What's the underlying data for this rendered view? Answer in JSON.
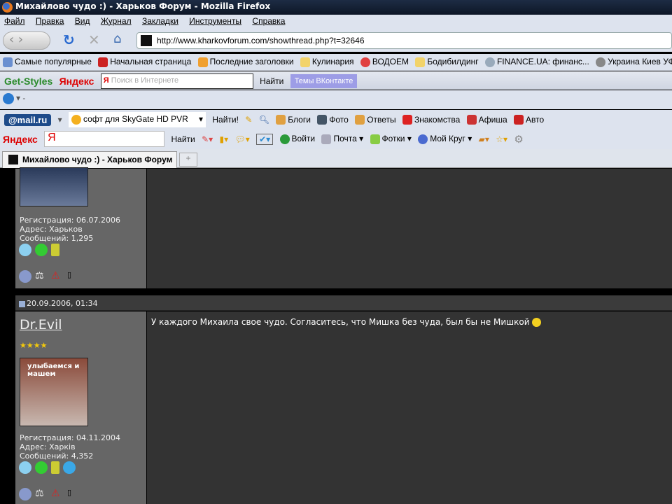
{
  "window": {
    "title": "Михайлово чудо :) - Харьков Форум - Mozilla Firefox"
  },
  "menu": [
    "Файл",
    "Правка",
    "Вид",
    "Журнал",
    "Закладки",
    "Инструменты",
    "Справка"
  ],
  "nav": {
    "url": "http://www.kharkovforum.com/showthread.php?t=32646"
  },
  "bookmarks": [
    "Самые популярные",
    "Начальная страница",
    "Последние заголовки",
    "Кулинария",
    "ВОДОЕМ",
    "Бодибилдинг",
    "FINANCE.UA: финанс...",
    "Украина Киев УФ"
  ],
  "getstyles": {
    "title": "Get-Styles",
    "yandex": "Яндекс",
    "placeholder": "Поиск в Интернете",
    "find": "Найти",
    "vk": "Темы ВКонтакте"
  },
  "mailbar": {
    "logo": "@mail.ru",
    "query": "софт для SkyGate HD PVR",
    "find": "Найти!",
    "links": [
      "Блоги",
      "Фото",
      "Ответы",
      "Знакомства",
      "Афиша",
      "Авто"
    ]
  },
  "yabar": {
    "logo": "Яндекс",
    "find": "Найти",
    "links": [
      "Войти",
      "Почта",
      "Фотки",
      "Мой Круг"
    ]
  },
  "tabs": [
    {
      "label": "Михайлово чудо :) - Харьков Форум"
    }
  ],
  "posts": [
    {
      "registration": "Регистрация: 06.07.2006",
      "address": "Адрес: Харьков",
      "messages": "Сообщений: 1,295"
    },
    {
      "date": "20.09.2006, 01:34",
      "username": "Dr.Evil",
      "stars": "★★★★",
      "avatar_text": "улыбаемся и машем",
      "registration": "Регистрация: 04.11.2004",
      "address": "Адрес: Харків",
      "messages": "Сообщений: 4,352",
      "text": "У каждого Михаила свое чудо. Согласитесь, что Мишка без чуда, был бы не Мишкой"
    }
  ]
}
